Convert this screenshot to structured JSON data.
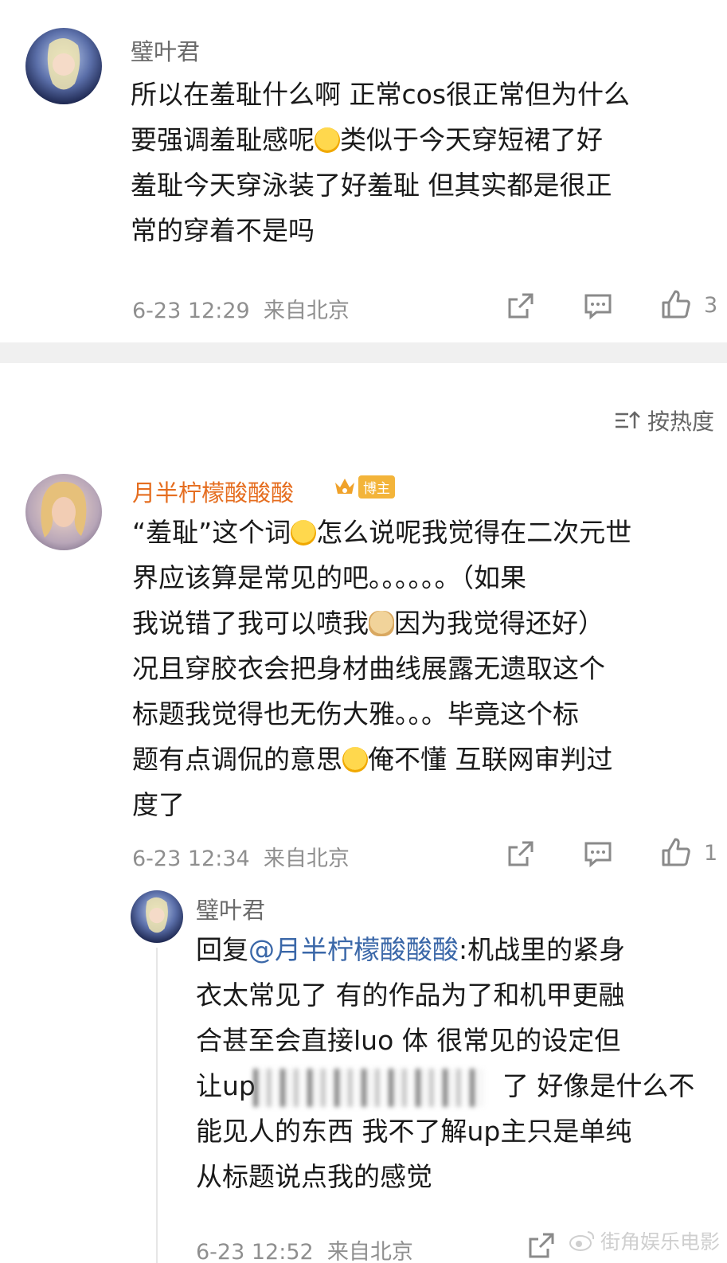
{
  "comments": [
    {
      "username": "璧叶君",
      "text": "所以在羞耻什么啊 正常cos很正常但为什么\n要强调羞耻感呢",
      "text2": "类似于今天穿短裙了好\n羞耻今天穿泳装了好羞耻 但其实都是很正\n常的穿着不是吗",
      "time": "6-23 12:29",
      "location": "来自北京",
      "likes": "3"
    },
    {
      "username": "月半柠檬酸酸酸",
      "badge": "博主",
      "text_a": "“羞耻”这个词",
      "text_b": "怎么说呢我觉得在二次元世\n界应该算是常见的吧。。。。。。（如果\n我说错了我可以喷我",
      "text_c": "因为我觉得还好）\n况且穿胶衣会把身材曲线展露无遗取这个\n标题我觉得也无伤大雅。。。毕竟这个标\n题有点调侃的意思",
      "text_d": "俺不懂 互联网审判过\n度了",
      "time": "6-23 12:34",
      "location": "来自北京",
      "likes": "1"
    },
    {
      "username": "璧叶君",
      "reply_prefix": "回复",
      "mention": "@月半柠檬酸酸酸",
      "text": ":机战里的紧身\n衣太常见了 有的作品为了和机甲更融\n合甚至会直接luo 体 很常见的设定但\n让up",
      "text_tail": "了 好像是什么不\n能见人的东西 我不了解up主只是单纯\n从标题说点我的感觉",
      "time": "6-23 12:52",
      "location": "来自北京"
    }
  ],
  "sort_label": "按热度",
  "watermark": "街角娱乐电影",
  "colors": {
    "username_vip": "#e56d1f",
    "mention": "#3a67a8",
    "meta": "#8f8f8f"
  }
}
